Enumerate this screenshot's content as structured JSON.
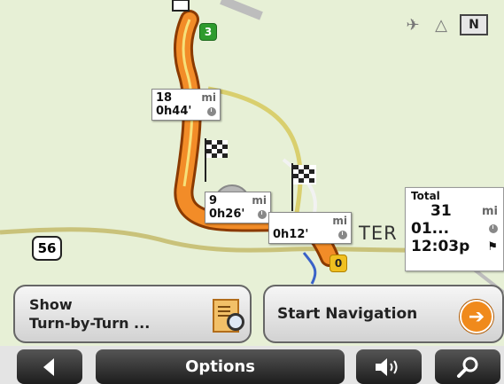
{
  "status": {
    "compass": "N",
    "icons": [
      "gps-satellite-icon",
      "antenna-icon"
    ]
  },
  "route_boxes": [
    {
      "distance": "18",
      "unit": "mi",
      "time": "0h44'"
    },
    {
      "distance": "9",
      "unit": "mi",
      "time": "0h26'"
    },
    {
      "distance": "",
      "unit": "mi",
      "time": "0h12'"
    }
  ],
  "total": {
    "label": "Total",
    "distance": "31",
    "unit": "mi",
    "time": "01...",
    "arrival": "12:03p"
  },
  "map_labels": {
    "road_shield": "56",
    "green_badge": "3",
    "yellow_badge": "0",
    "city_fragment": "TER"
  },
  "buttons": {
    "show_line1": "Show",
    "show_line2": "Turn-by-Turn ...",
    "start": "Start Navigation"
  },
  "toolbar": {
    "options": "Options",
    "back_icon": "left-arrow-icon",
    "volume_icon": "speaker-icon",
    "search_icon": "magnifier-icon"
  }
}
